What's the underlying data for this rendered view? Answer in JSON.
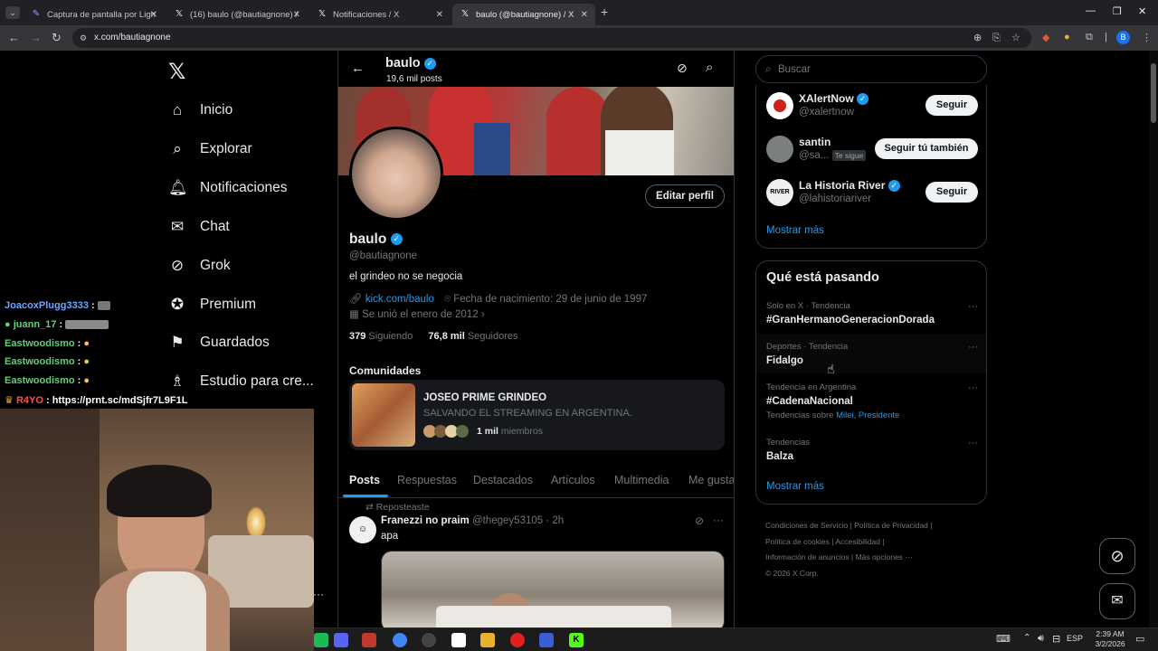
{
  "browser": {
    "tabs": [
      {
        "label": "Captura de pantalla por Lightsh",
        "icon": "feather-icon",
        "active": false
      },
      {
        "label": "(16) baulo (@bautiagnone) / X",
        "icon": "x-logo-icon",
        "active": false
      },
      {
        "label": "Notificaciones / X",
        "icon": "x-logo-icon",
        "active": false
      },
      {
        "label": "baulo (@bautiagnone) / X",
        "icon": "x-logo-icon",
        "active": true
      }
    ],
    "new_tab": "+",
    "url": "x.com/bautiagnone",
    "profile_initial": "B"
  },
  "nav": {
    "logo": "𝕏",
    "items": [
      {
        "label": "Inicio",
        "icon": "home-icon",
        "glyph": "⌂"
      },
      {
        "label": "Explorar",
        "icon": "search-icon",
        "glyph": "⌕"
      },
      {
        "label": "Notificaciones",
        "icon": "bell-icon",
        "glyph": "🔔︎"
      },
      {
        "label": "Chat",
        "icon": "mail-icon",
        "glyph": "✉"
      },
      {
        "label": "Grok",
        "icon": "grok-icon",
        "glyph": "⊘"
      },
      {
        "label": "Premium",
        "icon": "verified-icon",
        "glyph": "✪"
      },
      {
        "label": "Guardados",
        "icon": "bookmark-icon",
        "glyph": "⚑"
      },
      {
        "label": "Estudio para cre...",
        "icon": "creator-studio-icon",
        "glyph": "♗"
      }
    ]
  },
  "chat_overlay": [
    {
      "user": "JoacoxPlugg3333",
      "color": "#6aa6ff",
      "msg": ""
    },
    {
      "user": "juann_17",
      "color": "#5fd07a",
      "msg": ""
    },
    {
      "user": "Eastwoodismo",
      "color": "#5fd07a",
      "msg": ""
    },
    {
      "user": "Eastwoodismo",
      "color": "#5fd07a",
      "msg": ""
    },
    {
      "user": "Eastwoodismo",
      "color": "#5fd07a",
      "msg": ""
    },
    {
      "user": "R4YO",
      "color": "#ff4d4d",
      "msg": "https://prnt.sc/mdSjfr7L9F1L"
    }
  ],
  "profile": {
    "header_name": "baulo",
    "header_posts": "19,6 mil posts",
    "edit_button": "Editar perfil",
    "name": "baulo",
    "handle": "@bautiagnone",
    "bio": "el grindeo no se negocia",
    "link": "kick.com/baulo",
    "birthday": "Fecha de nacimiento: 29 de junio de 1997",
    "joined": "Se unió el enero de 2012",
    "following_count": "379",
    "following_label": "Siguiendo",
    "followers_count": "76,8 mil",
    "followers_label": "Seguidores",
    "communities_title": "Comunidades",
    "community": {
      "name": "JOSEO PRIME GRINDEO",
      "description": "SALVANDO EL STREAMING EN ARGENTINA.",
      "members_count": "1 mil",
      "members_label": "miembros"
    },
    "tabs": [
      "Posts",
      "Respuestas",
      "Destacados",
      "Artículos",
      "Multimedia",
      "Me gusta"
    ],
    "active_tab": "Posts",
    "post": {
      "repost_label": "Reposteaste",
      "author": "Franezzi no praim",
      "handle": "@thegey53105",
      "time": "· 2h",
      "text": "apa"
    }
  },
  "right": {
    "search_placeholder": "Buscar",
    "who_to_follow": [
      {
        "name": "XAlertNow",
        "handle": "@xalertnow",
        "verified": true,
        "button": "Seguir",
        "follows_you": ""
      },
      {
        "name": "santin",
        "handle": "@sa...",
        "verified": false,
        "button": "Seguir tú también",
        "follows_you": "Te sigue"
      },
      {
        "name": "La Historia River",
        "handle": "@lahistoriariver",
        "verified": true,
        "button": "Seguir",
        "follows_you": ""
      }
    ],
    "show_more": "Mostrar más",
    "trends_title": "Qué está pasando",
    "trends": [
      {
        "context": "Solo en X · Tendencia",
        "title": "#GranHermanoGeneracionDorada",
        "related_prefix": "",
        "related": ""
      },
      {
        "context": "Deportes · Tendencia",
        "title": "Fidalgo",
        "related_prefix": "",
        "related": ""
      },
      {
        "context": "Tendencia en Argentina",
        "title": "#CadenaNacional",
        "related_prefix": "Tendencias sobre",
        "related": "Milei, Presidente"
      },
      {
        "context": "Tendencias",
        "title": "Balza",
        "related_prefix": "",
        "related": ""
      }
    ],
    "trends_show_more": "Mostrar más",
    "footer": {
      "line1a": "Condiciones de Servicio",
      "line1b": "Política de Privacidad",
      "line2a": "Política de cookies",
      "line2b": "Accesibilidad",
      "line3a": "Información de anuncios",
      "line3b": "Más opciones ···",
      "copyright": "© 2026 X Corp."
    }
  },
  "taskbar": {
    "lang": "ESP",
    "time": "2:39 AM",
    "date": "3/2/2026"
  },
  "colors": {
    "accent": "#1d9bf0",
    "background": "#000000",
    "border": "#2f3336",
    "muted": "#71767b"
  }
}
